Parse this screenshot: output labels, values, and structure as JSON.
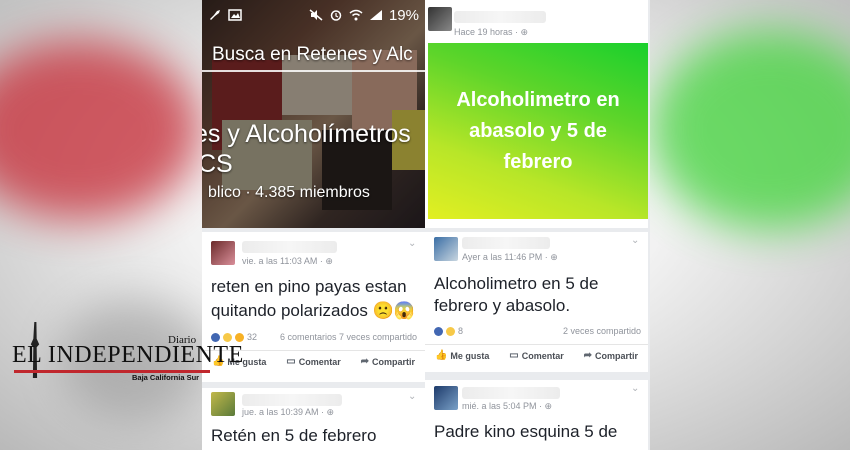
{
  "colors": {
    "brand_red": "#c0272d",
    "green_banner": "#19d02d",
    "yellow_banner": "#e2ef22",
    "like_blue": "#4267b2"
  },
  "status_bar": {
    "battery_percent": "19%"
  },
  "group": {
    "title_line1": "Busca en Retenes y Alc",
    "title_line2": "es y Alcoholímetros",
    "title_line3": "CS",
    "info": "blico · 4.385 miembros"
  },
  "left_posts": [
    {
      "meta": "vie. a las 11:03 AM · ⊕",
      "text_line1": "reten en pino payas estan",
      "text_line2": "quitando polarizados 🙁😱",
      "reactions_count": "32",
      "stats": "6 comentarios 7 veces compartido"
    },
    {
      "meta": "jue. a las 10:39 AM · ⊕",
      "text_line1": "Retén en 5 de febrero"
    }
  ],
  "right_posts": [
    {
      "meta": "Hace 19 horas · ⊕",
      "banner_text": "Alcoholimetro en abasolo y 5 de febrero"
    },
    {
      "meta": "Ayer a las 11:46 PM · ⊕",
      "text_line1": "Alcoholimetro en 5 de",
      "text_line2": "febrero y abasolo.",
      "reactions_count": "8",
      "stats": "2 veces compartido"
    },
    {
      "meta": "mié. a las 5:04 PM · ⊕",
      "text_line1": "Padre kino esquina 5 de"
    }
  ],
  "actions": {
    "like": "Me gusta",
    "comment": "Comentar",
    "share": "Compartir"
  },
  "icons": [
    "rocket-icon",
    "image-icon",
    "mute-icon",
    "alarm-icon",
    "wifi-icon",
    "signal-icon",
    "battery-icon",
    "chevron-down-icon",
    "like-icon",
    "comment-icon",
    "share-icon",
    "globe-icon"
  ],
  "logo": {
    "diario": "Diario",
    "name": "EL INDEPENDIENTE",
    "subtitle": "Baja California Sur"
  }
}
